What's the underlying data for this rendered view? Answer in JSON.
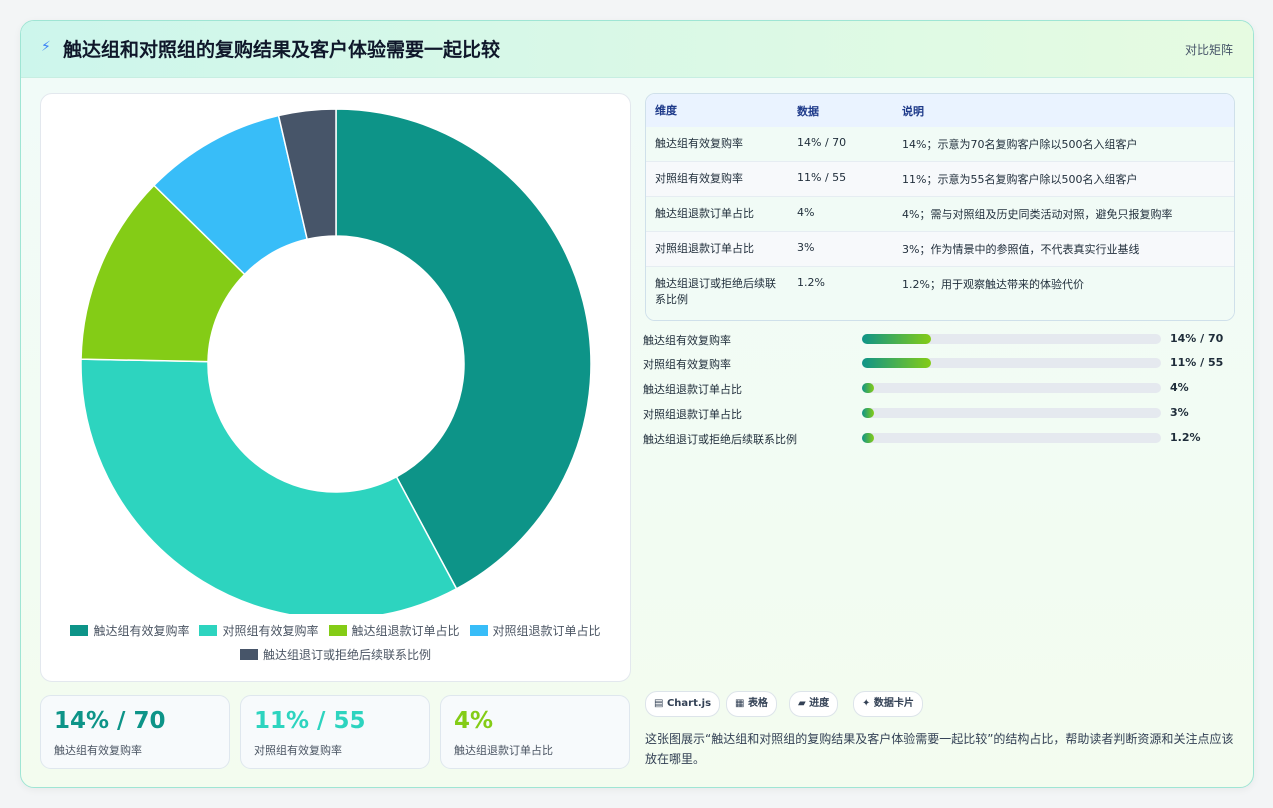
{
  "header": {
    "icon": "bolt-icon",
    "title": "触达组和对照组的复购结果及客户体验需要一起比较",
    "tag": "对比矩阵"
  },
  "chart_data": {
    "type": "pie",
    "variant": "donut",
    "categories": [
      "触达组有效复购率",
      "对照组有效复购率",
      "触达组退款订单占比",
      "对照组退款订单占比",
      "触达组退订或拒绝后续联系比例"
    ],
    "values": [
      14,
      11,
      4,
      3,
      1.2
    ],
    "colors": [
      "#0d9488",
      "#2dd4bf",
      "#84cc16",
      "#38bdf8",
      "#475569"
    ],
    "legend_position": "bottom"
  },
  "kpis": [
    {
      "value": "14% / 70",
      "label": "触达组有效复购率",
      "color": "#0d9488"
    },
    {
      "value": "11% / 55",
      "label": "对照组有效复购率",
      "color": "#2dd4bf"
    },
    {
      "value": "4%",
      "label": "触达组退款订单占比",
      "color": "#84cc16"
    }
  ],
  "table": {
    "headers": [
      "维度",
      "数据",
      "说明"
    ],
    "rows": [
      [
        "触达组有效复购率",
        "14% / 70",
        "14%；示意为70名复购客户除以500名入组客户"
      ],
      [
        "对照组有效复购率",
        "11% / 55",
        "11%；示意为55名复购客户除以500名入组客户"
      ],
      [
        "触达组退款订单占比",
        "4%",
        "4%；需与对照组及历史同类活动对照，避免只报复购率"
      ],
      [
        "对照组退款订单占比",
        "3%",
        "3%；作为情景中的参照值，不代表真实行业基线"
      ],
      [
        "触达组退订或拒绝后续联系比例",
        "1.2%",
        "1.2%；用于观察触达带来的体验代价"
      ]
    ]
  },
  "progress": [
    {
      "label": "触达组有效复购率",
      "value": "14% / 70",
      "fraction": 0.23
    },
    {
      "label": "对照组有效复购率",
      "value": "11% / 55",
      "fraction": 0.23
    },
    {
      "label": "触达组退款订单占比",
      "value": "4%",
      "fraction": 0.04
    },
    {
      "label": "对照组退款订单占比",
      "value": "3%",
      "fraction": 0.04
    },
    {
      "label": "触达组退订或拒绝后续联系比例",
      "value": "1.2%",
      "fraction": 0.04
    }
  ],
  "chips": [
    {
      "icon": "chart-icon",
      "label": "Chart.js"
    },
    {
      "icon": "table-icon",
      "label": "表格"
    },
    {
      "icon": "progress-icon",
      "label": "进度"
    },
    {
      "icon": "sparkle-icon",
      "label": "数据卡片"
    }
  ],
  "summary": "这张图展示“触达组和对照组的复购结果及客户体验需要一起比较”的结构占比，帮助读者判断资源和关注点应该放在哪里。"
}
